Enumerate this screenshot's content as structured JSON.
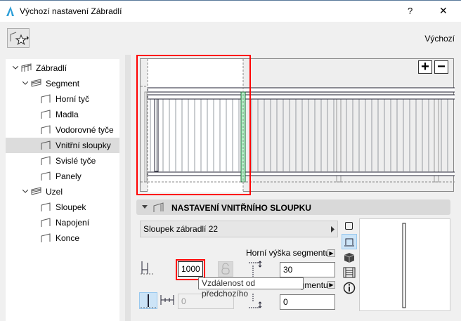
{
  "window": {
    "title": "Výchozí nastavení Zábradlí",
    "help": "?",
    "close": "✕"
  },
  "toolbar": {
    "defaults_label": "Výchozí"
  },
  "tree": [
    {
      "label": "Zábradlí",
      "level": 0,
      "expanded": true
    },
    {
      "label": "Segment",
      "level": 1,
      "expanded": true
    },
    {
      "label": "Horní tyč",
      "level": 2
    },
    {
      "label": "Madla",
      "level": 2
    },
    {
      "label": "Vodorovné tyče",
      "level": 2
    },
    {
      "label": "Vnitřní sloupky",
      "level": 2,
      "selected": true
    },
    {
      "label": "Svislé tyče",
      "level": 2
    },
    {
      "label": "Panely",
      "level": 2
    },
    {
      "label": "Uzel",
      "level": 1,
      "expanded": true
    },
    {
      "label": "Sloupek",
      "level": 2
    },
    {
      "label": "Napojení",
      "level": 2
    },
    {
      "label": "Konce",
      "level": 2
    }
  ],
  "preview": {
    "zoom_in": "+",
    "zoom_out": "−"
  },
  "section": {
    "title": "NASTAVENÍ VNITŘNÍHO SLOUPKU",
    "component": "Sloupek zábradlí 22",
    "top_height_label": "Horní výška segmentu",
    "bottom_height_label_visible": "egmentu",
    "distance_value": "1000",
    "offset_value": "0",
    "top_value": "30",
    "bottom_value": "0",
    "tooltip": "Vzdálenost od předchozího"
  }
}
